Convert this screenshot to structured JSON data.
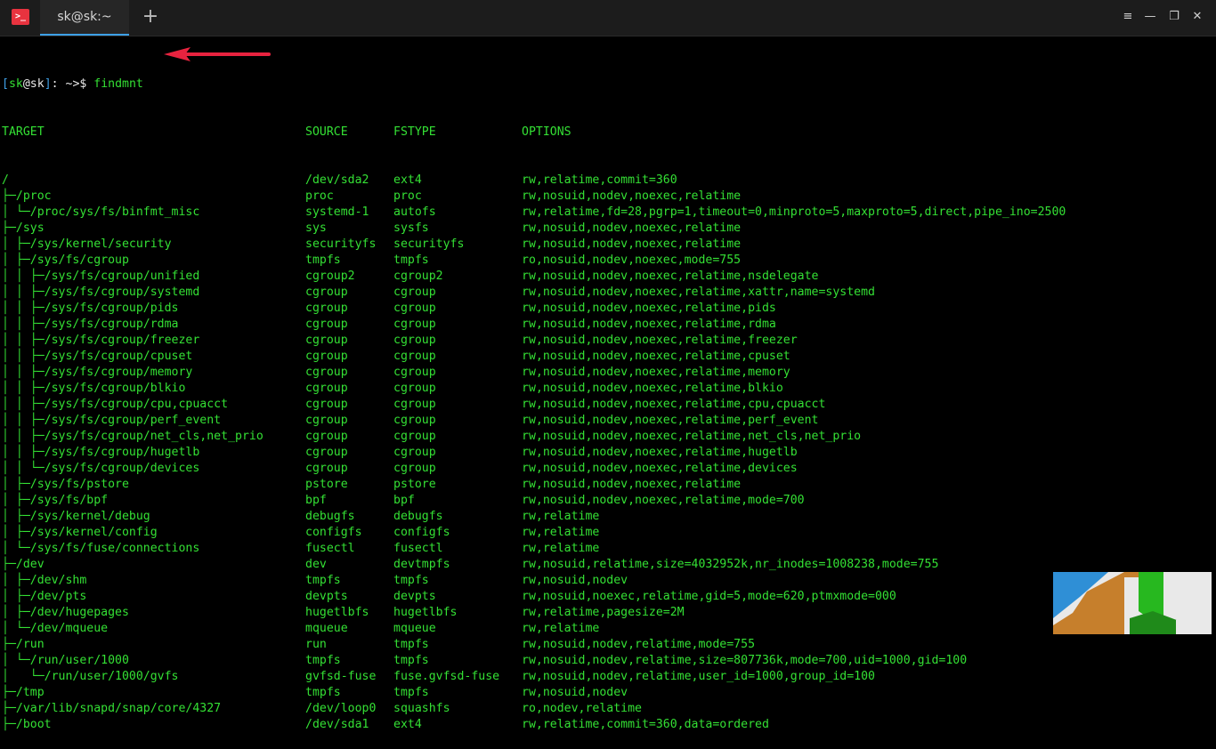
{
  "window": {
    "tab_title": "sk@sk:~",
    "app_icon_glyph": ">_",
    "new_tab_glyph": "+",
    "menu_glyph": "≡",
    "minimize_glyph": "—",
    "maximize_glyph": "❐",
    "close_glyph": "✕"
  },
  "prompt": {
    "open_bracket": "[",
    "user": "sk",
    "at": "@",
    "host": "sk",
    "close_bracket": "]",
    "rest": ": ~>$ ",
    "command": "findmnt"
  },
  "colors": {
    "terminal_green": "#34e034",
    "bracket_blue": "#3fa0e6",
    "arrow_red": "#e8233f",
    "tab_accent": "#3da0e6"
  },
  "table": {
    "headers": {
      "target": "TARGET",
      "source": "SOURCE",
      "fstype": "FSTYPE",
      "options": "OPTIONS"
    },
    "rows": [
      {
        "target": "/",
        "source": "/dev/sda2",
        "fstype": "ext4",
        "options": "rw,relatime,commit=360"
      },
      {
        "target": "├─/proc",
        "source": "proc",
        "fstype": "proc",
        "options": "rw,nosuid,nodev,noexec,relatime"
      },
      {
        "target": "│ └─/proc/sys/fs/binfmt_misc",
        "source": "systemd-1",
        "fstype": "autofs",
        "options": "rw,relatime,fd=28,pgrp=1,timeout=0,minproto=5,maxproto=5,direct,pipe_ino=2500"
      },
      {
        "target": "├─/sys",
        "source": "sys",
        "fstype": "sysfs",
        "options": "rw,nosuid,nodev,noexec,relatime"
      },
      {
        "target": "│ ├─/sys/kernel/security",
        "source": "securityfs",
        "fstype": "securityfs",
        "options": "rw,nosuid,nodev,noexec,relatime"
      },
      {
        "target": "│ ├─/sys/fs/cgroup",
        "source": "tmpfs",
        "fstype": "tmpfs",
        "options": "ro,nosuid,nodev,noexec,mode=755"
      },
      {
        "target": "│ │ ├─/sys/fs/cgroup/unified",
        "source": "cgroup2",
        "fstype": "cgroup2",
        "options": "rw,nosuid,nodev,noexec,relatime,nsdelegate"
      },
      {
        "target": "│ │ ├─/sys/fs/cgroup/systemd",
        "source": "cgroup",
        "fstype": "cgroup",
        "options": "rw,nosuid,nodev,noexec,relatime,xattr,name=systemd"
      },
      {
        "target": "│ │ ├─/sys/fs/cgroup/pids",
        "source": "cgroup",
        "fstype": "cgroup",
        "options": "rw,nosuid,nodev,noexec,relatime,pids"
      },
      {
        "target": "│ │ ├─/sys/fs/cgroup/rdma",
        "source": "cgroup",
        "fstype": "cgroup",
        "options": "rw,nosuid,nodev,noexec,relatime,rdma"
      },
      {
        "target": "│ │ ├─/sys/fs/cgroup/freezer",
        "source": "cgroup",
        "fstype": "cgroup",
        "options": "rw,nosuid,nodev,noexec,relatime,freezer"
      },
      {
        "target": "│ │ ├─/sys/fs/cgroup/cpuset",
        "source": "cgroup",
        "fstype": "cgroup",
        "options": "rw,nosuid,nodev,noexec,relatime,cpuset"
      },
      {
        "target": "│ │ ├─/sys/fs/cgroup/memory",
        "source": "cgroup",
        "fstype": "cgroup",
        "options": "rw,nosuid,nodev,noexec,relatime,memory"
      },
      {
        "target": "│ │ ├─/sys/fs/cgroup/blkio",
        "source": "cgroup",
        "fstype": "cgroup",
        "options": "rw,nosuid,nodev,noexec,relatime,blkio"
      },
      {
        "target": "│ │ ├─/sys/fs/cgroup/cpu,cpuacct",
        "source": "cgroup",
        "fstype": "cgroup",
        "options": "rw,nosuid,nodev,noexec,relatime,cpu,cpuacct"
      },
      {
        "target": "│ │ ├─/sys/fs/cgroup/perf_event",
        "source": "cgroup",
        "fstype": "cgroup",
        "options": "rw,nosuid,nodev,noexec,relatime,perf_event"
      },
      {
        "target": "│ │ ├─/sys/fs/cgroup/net_cls,net_prio",
        "source": "cgroup",
        "fstype": "cgroup",
        "options": "rw,nosuid,nodev,noexec,relatime,net_cls,net_prio"
      },
      {
        "target": "│ │ ├─/sys/fs/cgroup/hugetlb",
        "source": "cgroup",
        "fstype": "cgroup",
        "options": "rw,nosuid,nodev,noexec,relatime,hugetlb"
      },
      {
        "target": "│ │ └─/sys/fs/cgroup/devices",
        "source": "cgroup",
        "fstype": "cgroup",
        "options": "rw,nosuid,nodev,noexec,relatime,devices"
      },
      {
        "target": "│ ├─/sys/fs/pstore",
        "source": "pstore",
        "fstype": "pstore",
        "options": "rw,nosuid,nodev,noexec,relatime"
      },
      {
        "target": "│ ├─/sys/fs/bpf",
        "source": "bpf",
        "fstype": "bpf",
        "options": "rw,nosuid,nodev,noexec,relatime,mode=700"
      },
      {
        "target": "│ ├─/sys/kernel/debug",
        "source": "debugfs",
        "fstype": "debugfs",
        "options": "rw,relatime"
      },
      {
        "target": "│ ├─/sys/kernel/config",
        "source": "configfs",
        "fstype": "configfs",
        "options": "rw,relatime"
      },
      {
        "target": "│ └─/sys/fs/fuse/connections",
        "source": "fusectl",
        "fstype": "fusectl",
        "options": "rw,relatime"
      },
      {
        "target": "├─/dev",
        "source": "dev",
        "fstype": "devtmpfs",
        "options": "rw,nosuid,relatime,size=4032952k,nr_inodes=1008238,mode=755"
      },
      {
        "target": "│ ├─/dev/shm",
        "source": "tmpfs",
        "fstype": "tmpfs",
        "options": "rw,nosuid,nodev"
      },
      {
        "target": "│ ├─/dev/pts",
        "source": "devpts",
        "fstype": "devpts",
        "options": "rw,nosuid,noexec,relatime,gid=5,mode=620,ptmxmode=000"
      },
      {
        "target": "│ ├─/dev/hugepages",
        "source": "hugetlbfs",
        "fstype": "hugetlbfs",
        "options": "rw,relatime,pagesize=2M"
      },
      {
        "target": "│ └─/dev/mqueue",
        "source": "mqueue",
        "fstype": "mqueue",
        "options": "rw,relatime"
      },
      {
        "target": "├─/run",
        "source": "run",
        "fstype": "tmpfs",
        "options": "rw,nosuid,nodev,relatime,mode=755"
      },
      {
        "target": "│ └─/run/user/1000",
        "source": "tmpfs",
        "fstype": "tmpfs",
        "options": "rw,nosuid,nodev,relatime,size=807736k,mode=700,uid=1000,gid=100"
      },
      {
        "target": "│   └─/run/user/1000/gvfs",
        "source": "gvfsd-fuse",
        "fstype": "fuse.gvfsd-fuse",
        "options": "rw,nosuid,nodev,relatime,user_id=1000,group_id=100"
      },
      {
        "target": "├─/tmp",
        "source": "tmpfs",
        "fstype": "tmpfs",
        "options": "rw,nosuid,nodev"
      },
      {
        "target": "├─/var/lib/snapd/snap/core/4327",
        "source": "/dev/loop0",
        "fstype": "squashfs",
        "options": "ro,nodev,relatime"
      },
      {
        "target": "├─/boot",
        "source": "/dev/sda1",
        "fstype": "ext4",
        "options": "rw,relatime,commit=360,data=ordered"
      }
    ]
  }
}
